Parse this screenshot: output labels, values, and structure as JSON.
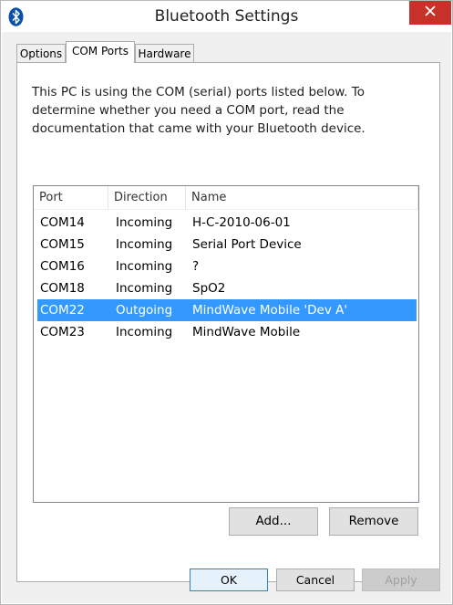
{
  "window": {
    "title": "Bluetooth Settings"
  },
  "tabs": [
    {
      "label": "Options"
    },
    {
      "label": "COM Ports"
    },
    {
      "label": "Hardware"
    }
  ],
  "description": "This PC is using the COM (serial) ports listed below. To determine whether you need a COM port, read the documentation that came with your Bluetooth device.",
  "list": {
    "columns": [
      "Port",
      "Direction",
      "Name"
    ],
    "rows": [
      {
        "port": "COM14",
        "direction": "Incoming",
        "name": "H-C-2010-06-01"
      },
      {
        "port": "COM15",
        "direction": "Incoming",
        "name": "Serial Port Device"
      },
      {
        "port": "COM16",
        "direction": "Incoming",
        "name": "?"
      },
      {
        "port": "COM18",
        "direction": "Incoming",
        "name": "SpO2"
      },
      {
        "port": "COM22",
        "direction": "Outgoing",
        "name": "MindWave Mobile 'Dev A'"
      },
      {
        "port": "COM23",
        "direction": "Incoming",
        "name": "MindWave Mobile"
      }
    ],
    "selected_index": 4
  },
  "buttons": {
    "add": "Add...",
    "remove": "Remove",
    "ok": "OK",
    "cancel": "Cancel",
    "apply": "Apply"
  },
  "colors": {
    "selection": "#3399ff",
    "close_button": "#c7312a",
    "dialog_bg": "#f0f0f0"
  },
  "icons": {
    "app": "bluetooth-icon",
    "close": "close-icon"
  }
}
